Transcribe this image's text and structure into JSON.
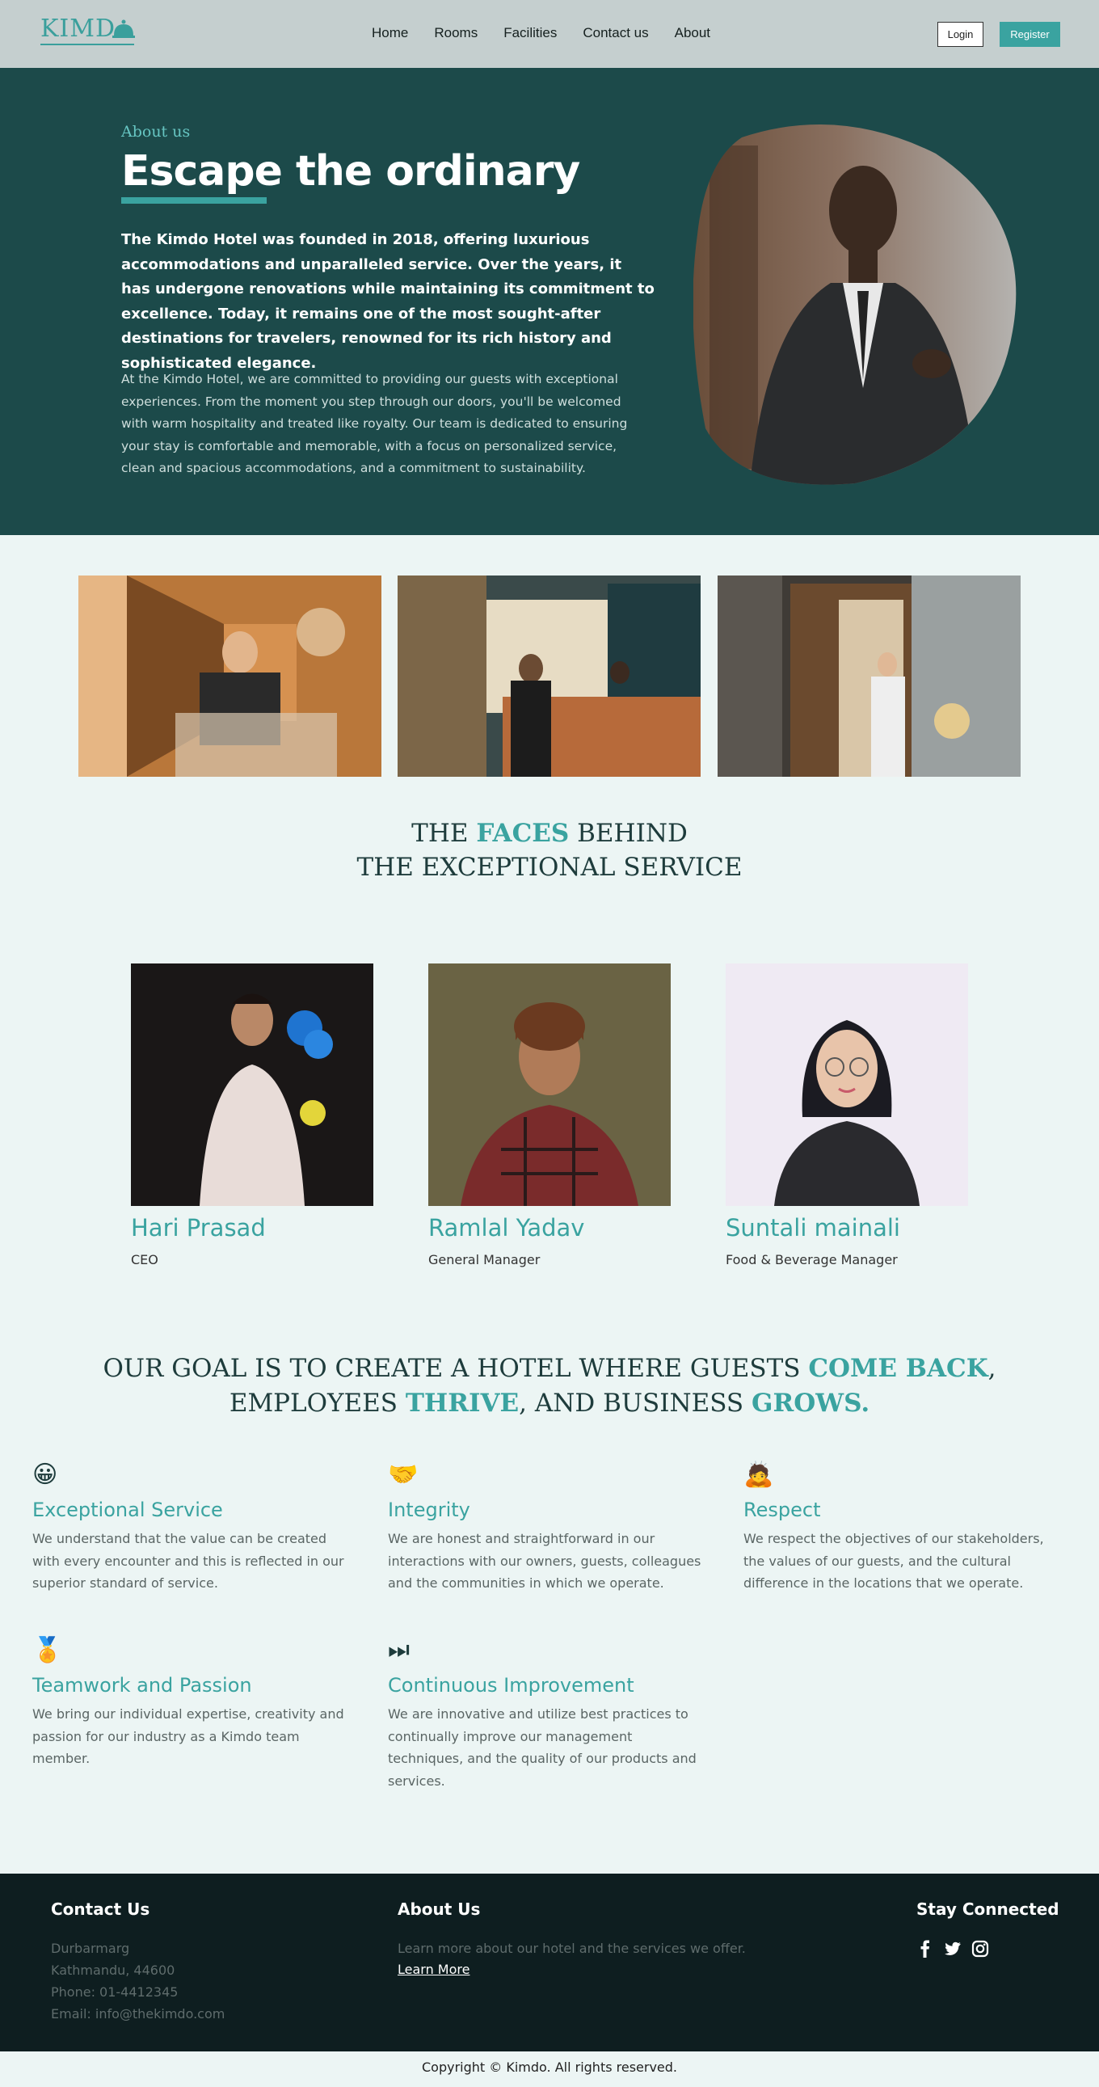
{
  "nav": {
    "logo_text": "KIMD",
    "links": [
      "Home",
      "Rooms",
      "Facilities",
      "Contact us",
      "About"
    ],
    "login_label": "Login",
    "register_label": "Register"
  },
  "hero": {
    "eyebrow": "About us",
    "title": "Escape the ordinary",
    "lead": "The Kimdo Hotel was founded in 2018, offering luxurious accommodations and unparalleled service. Over the years, it has undergone renovations while maintaining its commitment to excellence. Today, it remains one of the most sought-after destinations for travelers, renowned for its rich history and sophisticated elegance.",
    "body": "At the Kimdo Hotel, we are committed to providing our guests with exceptional experiences. From the moment you step through our doors, you'll be welcomed with warm hospitality and treated like royalty. Our team is dedicated to ensuring your stay is comfortable and memorable, with a focus on personalized service, clean and spacious accommodations, and a commitment to sustainability."
  },
  "faces": {
    "line1_pre": "THE ",
    "line1_accent": "FACES",
    "line1_post": " BEHIND",
    "line2": "THE EXCEPTIONAL SERVICE"
  },
  "team": [
    {
      "name": "Hari Prasad",
      "role": "CEO"
    },
    {
      "name": "Ramlal Yadav",
      "role": "General Manager"
    },
    {
      "name": "Suntali mainali",
      "role": "Food & Beverage Manager"
    }
  ],
  "goal": {
    "l1_pre": "OUR GOAL IS TO CREATE A HOTEL WHERE GUESTS ",
    "l1_accent": "COME BACK",
    "l1_post": ",",
    "l2_pre": "EMPLOYEES ",
    "l2_accent1": "THRIVE",
    "l2_mid": ", AND BUSINESS ",
    "l2_accent2": "GROWS."
  },
  "values": [
    {
      "icon": "😀",
      "icon_name": "smiley-icon",
      "title": "Exceptional Service",
      "desc": "We understand that the value can be created with every encounter and this is reflected in our superior standard of service."
    },
    {
      "icon": "🤝",
      "icon_name": "handshake-icon",
      "title": "Integrity",
      "desc": "We are honest and straightforward in our interactions with our owners, guests, colleagues and the communities in which we operate."
    },
    {
      "icon": "🙇",
      "icon_name": "bowing-person-icon",
      "title": "Respect",
      "desc": "We respect the objectives of our stakeholders, the values of our guests, and the cultural difference in the locations that we operate."
    },
    {
      "icon": "🏅",
      "icon_name": "medal-icon",
      "title": "Teamwork and Passion",
      "desc": "We bring our individual expertise, creativity and passion for our industry as a Kimdo team member."
    },
    {
      "icon": "⏭",
      "icon_name": "fast-forward-icon",
      "title": "Continuous Improvement",
      "desc": "We are innovative and utilize best practices to continually improve our management techniques, and the quality of our products and services."
    }
  ],
  "footer": {
    "contact_title": "Contact Us",
    "address1": "Durbarmarg",
    "address2": "Kathmandu, 44600",
    "phone": "Phone: 01-4412345",
    "email": "Email: info@thekimdo.com",
    "about_title": "About Us",
    "about_text": "Learn more about our hotel and the services we offer.",
    "learn_more": "Learn More",
    "connect_title": "Stay Connected",
    "social": [
      "facebook-icon",
      "twitter-icon",
      "instagram-icon"
    ]
  },
  "copyright": "Copyright © Kimdo. All rights reserved.",
  "colors": {
    "accent": "#3aa3a0",
    "hero_bg": "#1c4a4a",
    "footer_bg": "#0e1e20",
    "nav_bg": "#c5cfcf",
    "page_bg": "#ecf5f4"
  }
}
